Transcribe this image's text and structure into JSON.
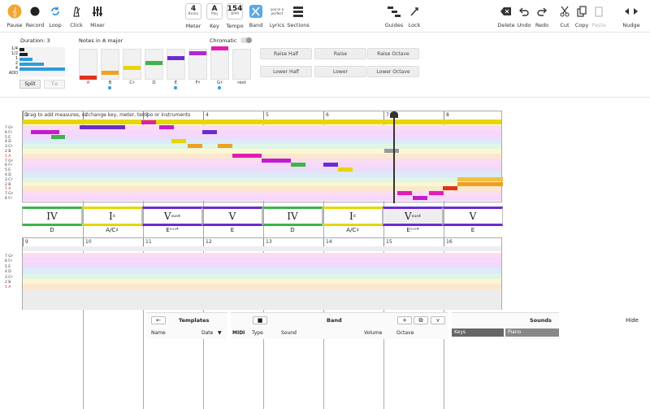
{
  "toolbar": {
    "pause": "Pause",
    "record": "Record",
    "loop": "Loop",
    "click": "Click",
    "mixer": "Mixer",
    "meter_value": "4",
    "meter_sub": "Beats",
    "meter": "Meter",
    "key_value": "A",
    "key_sub": "Maj",
    "key": "Key",
    "tempo_value": "154",
    "tempo_sub": "BPM",
    "tempo": "Tempo",
    "band": "Band",
    "lyrics": "Lyrics",
    "lyrics_sub1": "you're a",
    "lyrics_sub2": "perfect",
    "sections": "Sections",
    "guides": "Guides",
    "lock": "Lock",
    "delete": "Delete",
    "undo": "Undo",
    "redo": "Redo",
    "cut": "Cut",
    "copy": "Copy",
    "paste": "Paste",
    "nudge": "Nudge"
  },
  "editor": {
    "duration_label": "Duration: 3",
    "durations": [
      "1/4",
      "1/2",
      "1",
      "2",
      "4",
      "ADD"
    ],
    "split": "Split",
    "tie": "Tie",
    "notes_label": "Notes in A major",
    "chromatic": "Chromatic",
    "keys": [
      "A",
      "B",
      "C♯",
      "D",
      "E",
      "F♯",
      "G♯",
      "rest"
    ],
    "raise_half": "Raise Half",
    "raise": "Raise",
    "raise_octave": "Raise Octave",
    "lower_half": "Lower Half",
    "lower": "Lower",
    "lower_octave": "Lower Octave"
  },
  "track1": {
    "hint": "Drag to add measures, or change key, meter, tempo or instruments",
    "measures": [
      "1",
      "2",
      "3",
      "4",
      "5",
      "6",
      "7",
      "8"
    ],
    "lanes": [
      "7 G♯",
      "6 F♯",
      "5 E",
      "4 D",
      "3 C♯",
      "2 B",
      "1 A",
      "7 G♯",
      "6 F♯",
      "5 E",
      "4 D",
      "3 C♯",
      "2 B",
      "1 A",
      "7 G♯",
      "6 F♯"
    ],
    "chords": [
      {
        "roman": "IV",
        "sup": "",
        "name": "D"
      },
      {
        "roman": "I",
        "sup": "6",
        "name": "A/C♯"
      },
      {
        "roman": "V",
        "sup": "sus4",
        "name": "Eˢᵘˢ⁴"
      },
      {
        "roman": "V",
        "sup": "",
        "name": "E"
      },
      {
        "roman": "IV",
        "sup": "",
        "name": "D"
      },
      {
        "roman": "I",
        "sup": "6",
        "name": "A/C♯"
      },
      {
        "roman": "V",
        "sup": "sus4",
        "name": "Eˢᵘˢ⁴"
      },
      {
        "roman": "V",
        "sup": "",
        "name": "E"
      }
    ]
  },
  "track2": {
    "measures": [
      "9",
      "10",
      "11",
      "12",
      "13",
      "14",
      "15",
      "16"
    ],
    "lanes": [
      "7 G♯",
      "6 F♯",
      "5 E",
      "4 D",
      "3 C♯",
      "2 B",
      "1 A"
    ]
  },
  "bottom": {
    "templates": "Templates",
    "name": "Name",
    "date": "Date",
    "band": "Band",
    "midi": "MIDI",
    "type": "Type",
    "sound": "Sound",
    "volume": "Volume",
    "octave": "Octave",
    "sounds": "Sounds",
    "keys": "Keys",
    "piano": "Piano",
    "hide": "Hide"
  },
  "colors": {
    "accent": "#f0a020",
    "purple": "#6a2ccf",
    "yellow": "#e8d400",
    "green": "#3cb44b"
  }
}
